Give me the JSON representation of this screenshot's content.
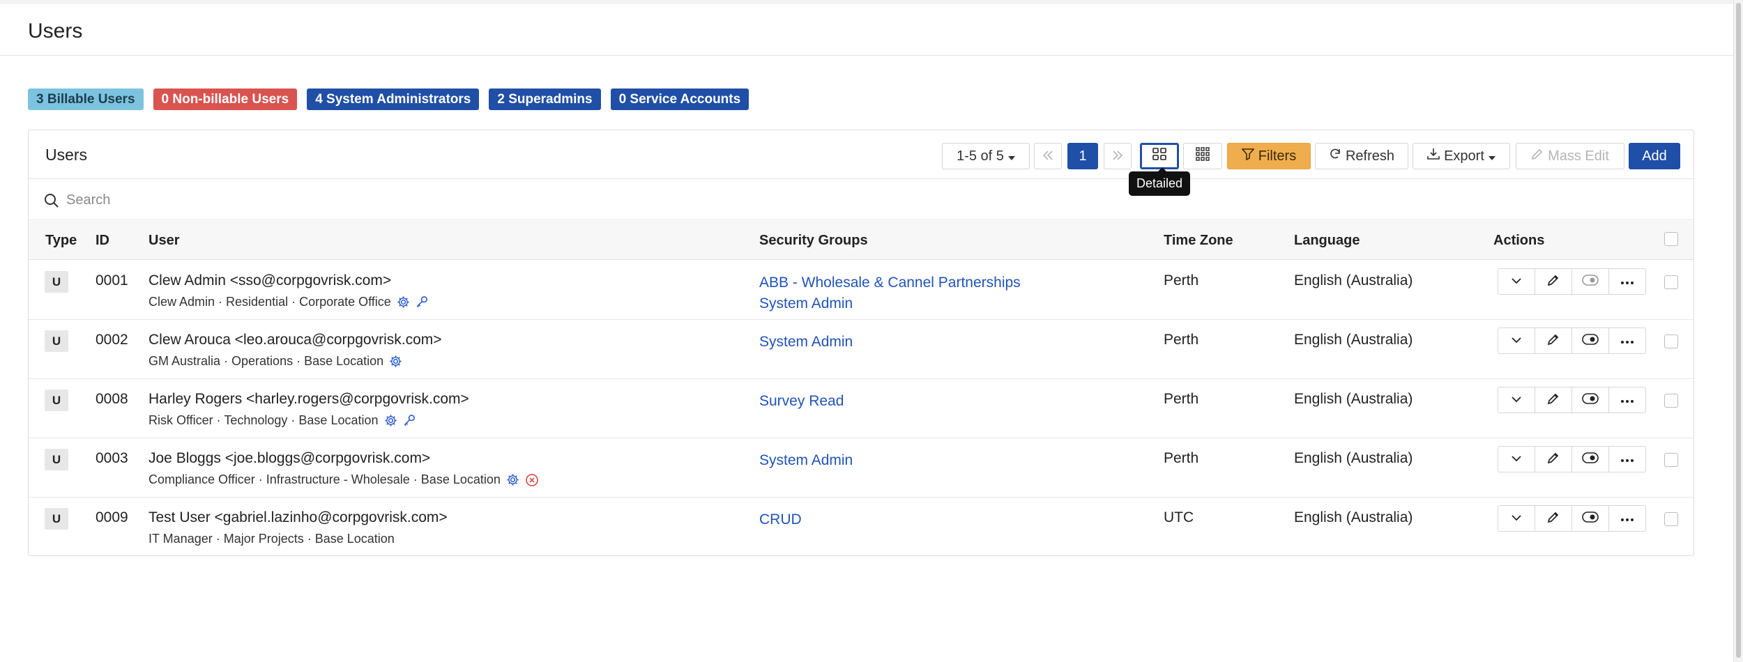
{
  "page": {
    "title": "Users"
  },
  "badges": {
    "billable": "3 Billable Users",
    "non_billable": "0 Non-billable Users",
    "sysadmins": "4 System Administrators",
    "superadmins": "2 Superadmins",
    "service": "0 Service Accounts"
  },
  "panel": {
    "title": "Users"
  },
  "toolbar": {
    "range": "1-5 of 5",
    "page": "1",
    "filters": "Filters",
    "refresh": "Refresh",
    "export": "Export",
    "mass_edit": "Mass Edit",
    "add": "Add",
    "tooltip": "Detailed"
  },
  "search": {
    "placeholder": "Search"
  },
  "columns": {
    "type": "Type",
    "id": "ID",
    "user": "User",
    "security_groups": "Security Groups",
    "time_zone": "Time Zone",
    "language": "Language",
    "actions": "Actions"
  },
  "rows": [
    {
      "type": "U",
      "id": "0001",
      "user": "Clew Admin <sso@corpgovrisk.com>",
      "details": "Clew Admin · Residential · Corporate Office",
      "groups": [
        "ABB - Wholesale & Cannel Partnerships",
        "System Admin"
      ],
      "tz": "Perth",
      "lang": "English (Australia)"
    },
    {
      "type": "U",
      "id": "0002",
      "user": "Clew Arouca <leo.arouca@corpgovrisk.com>",
      "details": "GM Australia · Operations · Base Location",
      "groups": [
        "System Admin"
      ],
      "tz": "Perth",
      "lang": "English (Australia)"
    },
    {
      "type": "U",
      "id": "0008",
      "user": "Harley Rogers <harley.rogers@corpgovrisk.com>",
      "details": "Risk Officer · Technology · Base Location",
      "groups": [
        "Survey Read"
      ],
      "tz": "Perth",
      "lang": "English (Australia)"
    },
    {
      "type": "U",
      "id": "0003",
      "user": "Joe Bloggs <joe.bloggs@corpgovrisk.com>",
      "details": "Compliance Officer · Infrastructure - Wholesale · Base Location",
      "groups": [
        "System Admin"
      ],
      "tz": "Perth",
      "lang": "English (Australia)"
    },
    {
      "type": "U",
      "id": "0009",
      "user": "Test User <gabriel.lazinho@corpgovrisk.com>",
      "details": "IT Manager · Major Projects · Base Location",
      "groups": [
        "CRUD"
      ],
      "tz": "UTC",
      "lang": "English (Australia)"
    }
  ]
}
